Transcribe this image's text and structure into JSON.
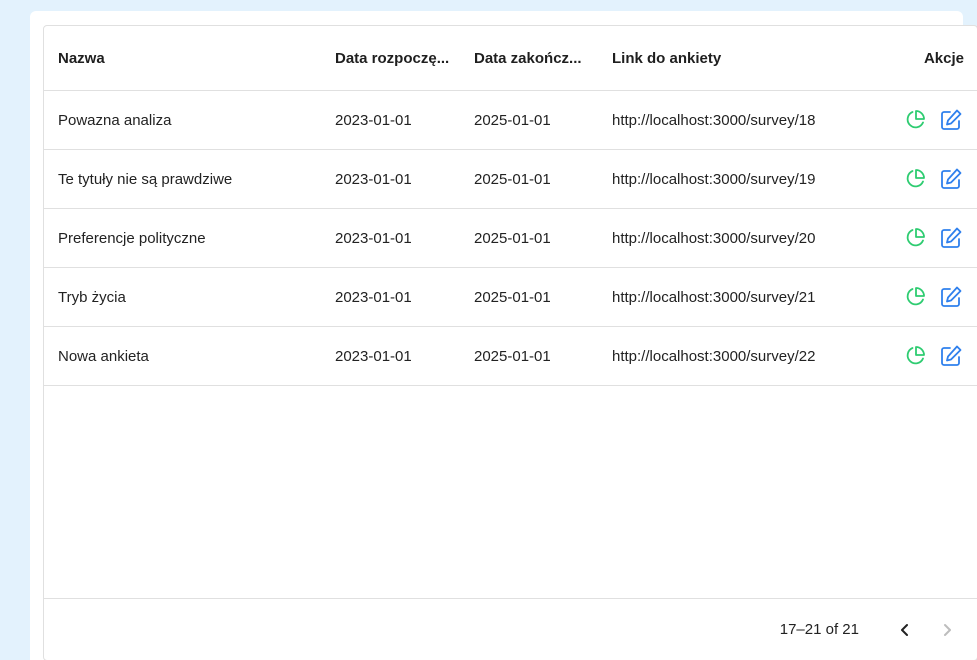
{
  "table": {
    "columns": [
      "Nazwa",
      "Data rozpoczę...",
      "Data zakończ...",
      "Link do ankiety",
      "Akcje"
    ],
    "rows": [
      {
        "name": "Powazna analiza",
        "start": "2023-01-01",
        "end": "2025-01-01",
        "link": "http://localhost:3000/survey/18"
      },
      {
        "name": "Te tytuły nie są prawdziwe",
        "start": "2023-01-01",
        "end": "2025-01-01",
        "link": "http://localhost:3000/survey/19"
      },
      {
        "name": "Preferencje polityczne",
        "start": "2023-01-01",
        "end": "2025-01-01",
        "link": "http://localhost:3000/survey/20"
      },
      {
        "name": "Tryb życia",
        "start": "2023-01-01",
        "end": "2025-01-01",
        "link": "http://localhost:3000/survey/21"
      },
      {
        "name": "Nowa ankieta",
        "start": "2023-01-01",
        "end": "2025-01-01",
        "link": "http://localhost:3000/survey/22"
      }
    ],
    "action_icons": [
      "pie-chart-icon",
      "edit-icon"
    ]
  },
  "pagination": {
    "range_text": "17–21 of 21"
  },
  "colors": {
    "background": "#e3f2fd",
    "stats_icon": "#2ecc71",
    "edit_icon": "#2f80ed"
  }
}
